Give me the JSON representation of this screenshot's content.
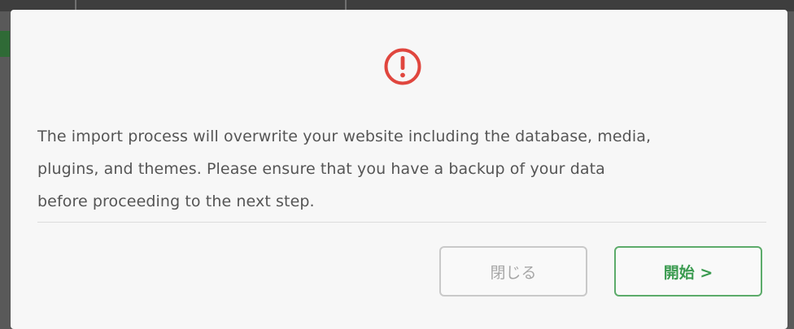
{
  "dialog": {
    "icon": "exclamation-circle-icon",
    "message_lines": [
      "The import process will overwrite your website including the database, media,",
      "plugins, and themes. Please ensure that you have a backup of your data",
      "before proceeding to the next step."
    ],
    "close_label": "閉じる",
    "start_label": "開始 >"
  },
  "colors": {
    "alert": "#e0463e",
    "accent": "#3b9b50",
    "close_border": "#c9c9c9",
    "modal_bg": "#f7f7f7",
    "backdrop": "#595959"
  }
}
